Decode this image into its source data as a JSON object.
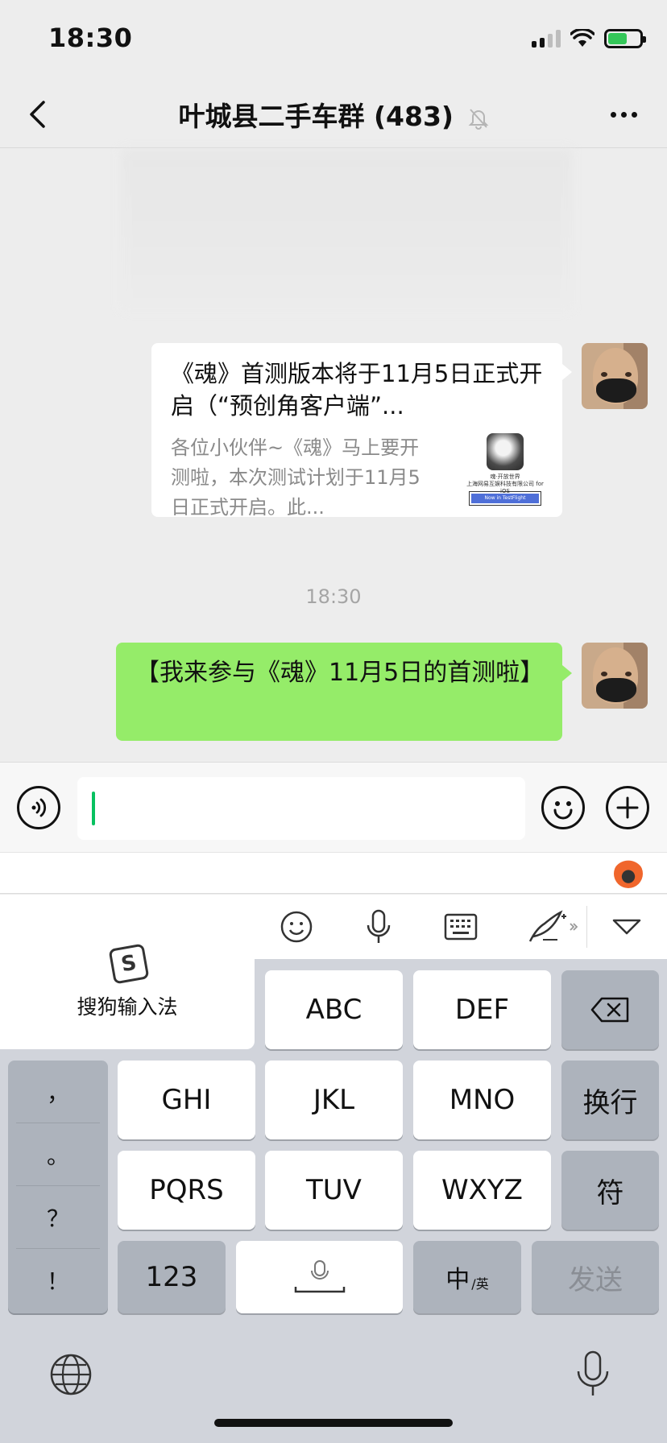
{
  "status_bar": {
    "time": "18:30"
  },
  "nav": {
    "title": "叶城县二手车群 (483)",
    "back_icon": "chevron-left-icon",
    "mute_icon": "bell-off-icon",
    "more_icon": "more-dots-icon"
  },
  "chat": {
    "messages": [
      {
        "type": "link-card",
        "title": "《魂》首测版本将于11月5日正式开启（“预创角客户端”...",
        "description": "各位小伙伴~《魂》马上要开测啦，本次测试计划于11月5日正式开启。此...",
        "thumb_caption": "魂·开放世界\n上海网易互娱科技有限公司 for iOS",
        "thumb_button": "Now in TestFlight"
      },
      {
        "type": "timestamp",
        "text": "18:30"
      },
      {
        "type": "text",
        "text": "【我来参与《魂》11月5日的首测啦】"
      }
    ]
  },
  "input_bar": {
    "voice_icon": "voice-icon",
    "emoji_icon": "emoji-icon",
    "plus_icon": "plus-icon",
    "value": ""
  },
  "keyboard": {
    "ime_name": "搜狗输入法",
    "toolbar_icons": [
      "emoji-icon",
      "microphone-icon",
      "keyboard-icon",
      "handwriting-icon",
      "collapse-icon"
    ],
    "rows": [
      [
        "ABC",
        "DEF"
      ],
      [
        "GHI",
        "JKL",
        "MNO",
        "换行"
      ],
      [
        "PQRS",
        "TUV",
        "WXYZ",
        "符"
      ],
      [
        "123",
        "",
        "中",
        "英",
        "发送"
      ]
    ],
    "punctuation": [
      "，",
      "。",
      "？",
      "！"
    ],
    "globe_icon": "globe-icon",
    "mic_icon": "microphone-icon"
  }
}
